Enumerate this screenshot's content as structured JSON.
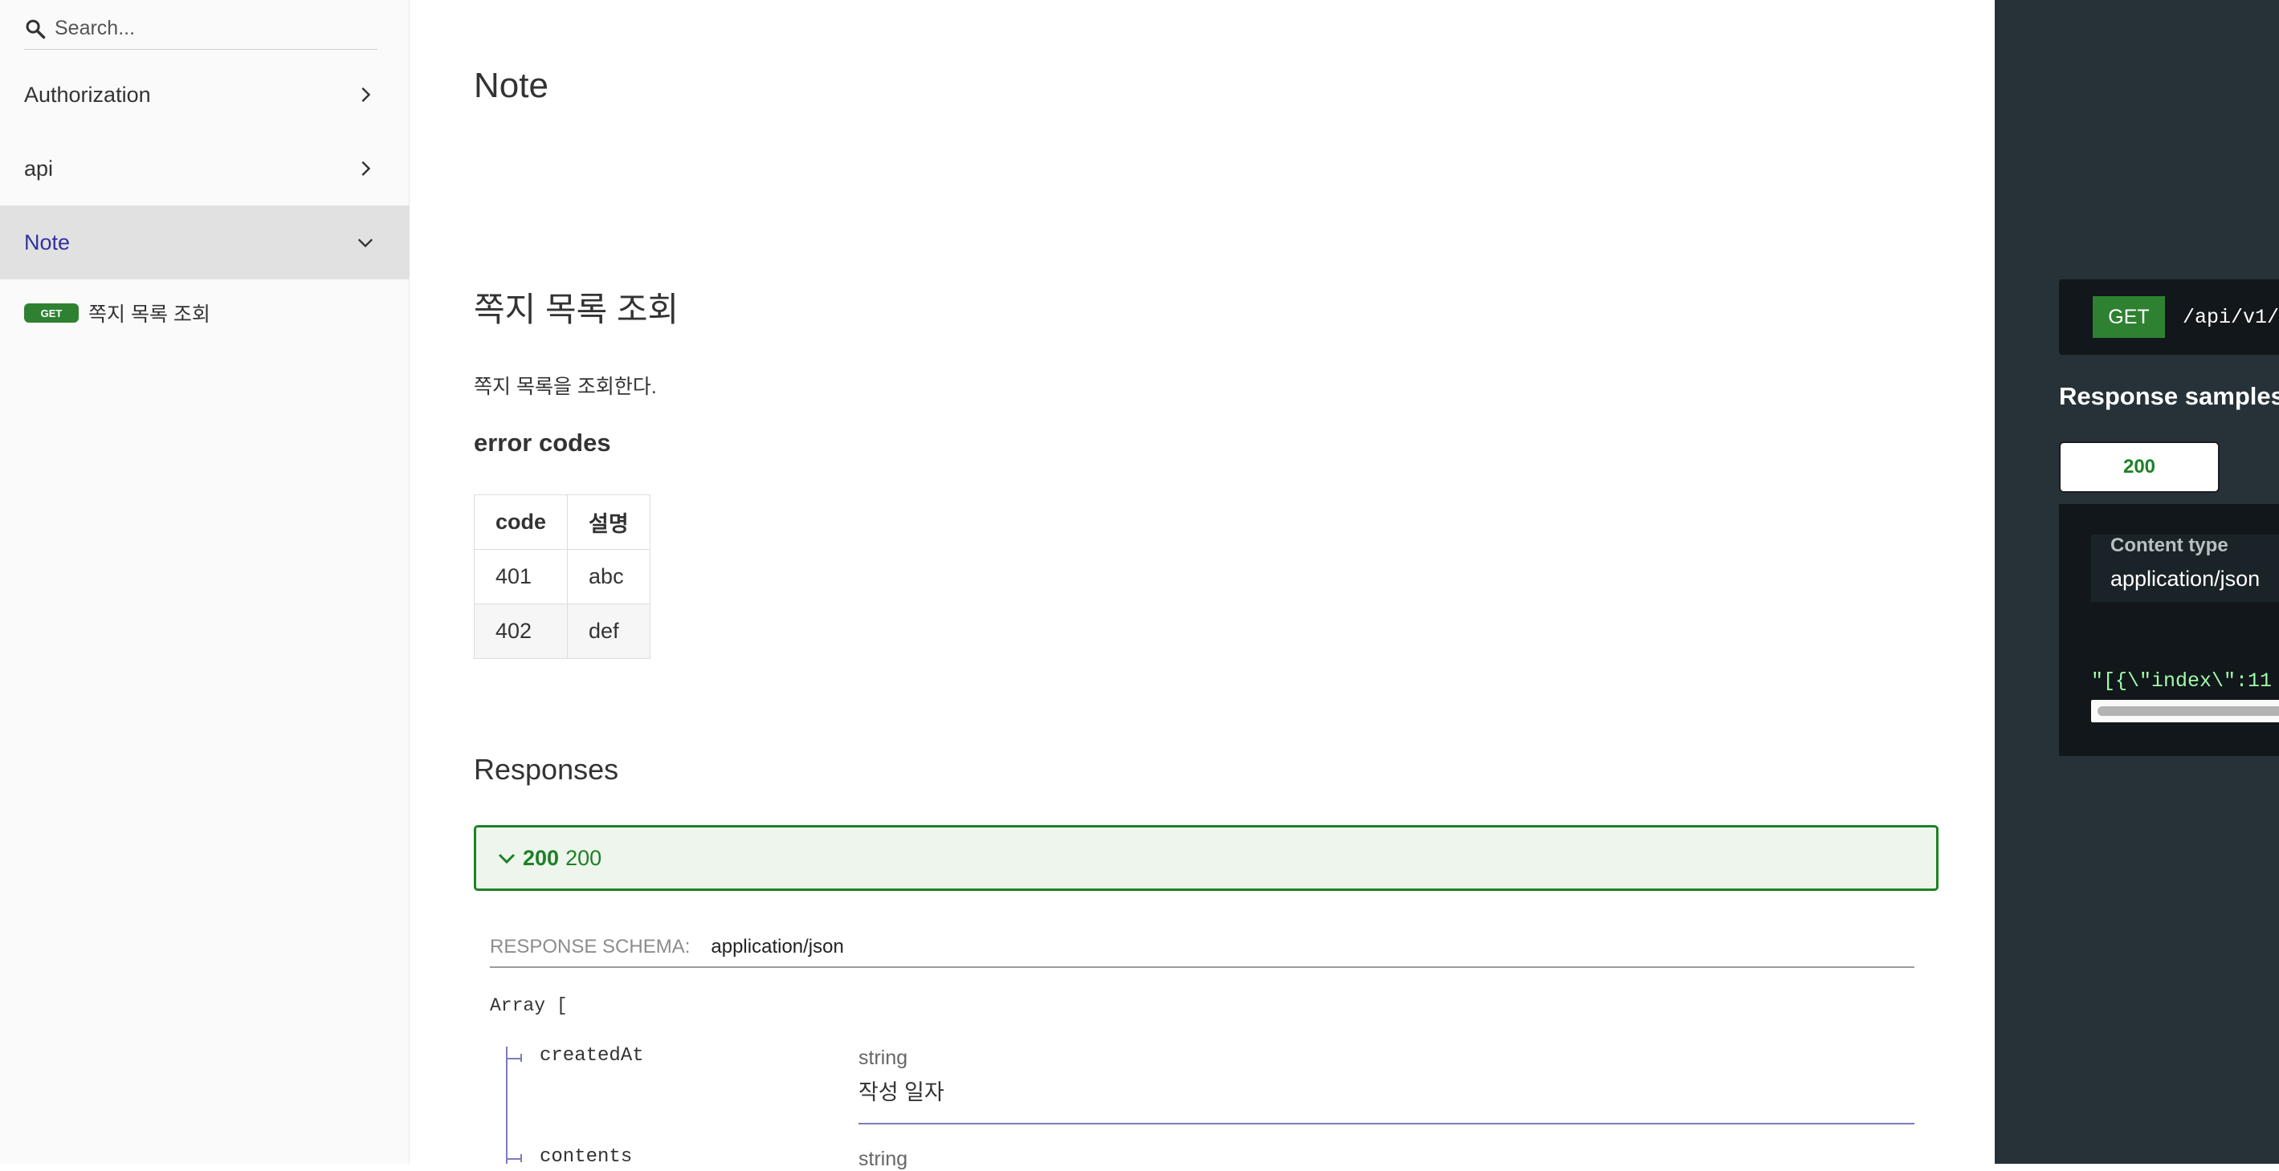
{
  "search": {
    "placeholder": "Search..."
  },
  "sidebar": {
    "items": [
      {
        "label": "Authorization"
      },
      {
        "label": "api"
      },
      {
        "label": "Note"
      }
    ],
    "sub_items": [
      {
        "method": "GET",
        "label": "쪽지 목록 조회"
      }
    ]
  },
  "main": {
    "section_title": "Note",
    "operation": {
      "title": "쪽지 목록 조회",
      "description": "쪽지 목록을 조회한다.",
      "errors_heading": "error codes",
      "errors_table": {
        "headers": [
          "code",
          "설명"
        ],
        "rows": [
          [
            "401",
            "abc"
          ],
          [
            "402",
            "def"
          ]
        ]
      }
    },
    "responses": {
      "heading": "Responses",
      "items": [
        {
          "code": "200",
          "description": "200"
        }
      ],
      "schema": {
        "label": "Response Schema:",
        "content_type": "application/json",
        "array_open": "Array [",
        "properties": [
          {
            "name": "createdAt",
            "type": "string",
            "description": "작성 일자"
          },
          {
            "name": "contents",
            "type": "string"
          }
        ]
      }
    }
  },
  "right_panel": {
    "method": "GET",
    "path": "/api/v1/",
    "samples_heading": "Response samples",
    "status_tab": "200",
    "content_type_label": "Content type",
    "content_type_value": "application/json",
    "code_preview": "\"[{\\\"index\\\":11"
  },
  "colors": {
    "accent_green": "#1d8127",
    "active_nav_text": "#32329f",
    "right_panel_bg": "#263238",
    "code_green": "#a0fbaa"
  }
}
